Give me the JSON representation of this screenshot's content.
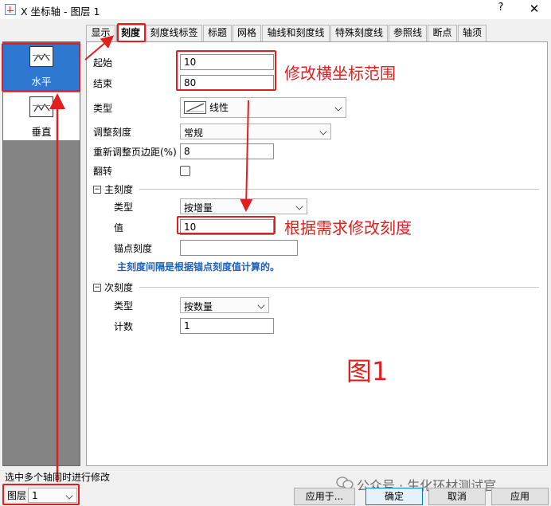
{
  "window": {
    "title": "X 坐标轴 - 图层 1",
    "help": "?",
    "close": "✕"
  },
  "sidebar": {
    "items": [
      {
        "label": "水平",
        "selected": true
      },
      {
        "label": "垂直",
        "selected": false
      }
    ]
  },
  "tabs": [
    "显示",
    "刻度",
    "刻度线标签",
    "标题",
    "网格",
    "轴线和刻度线",
    "特殊刻度线",
    "参照线",
    "断点",
    "轴须"
  ],
  "active_tab": "刻度",
  "scale": {
    "from_label": "起始",
    "from_value": "10",
    "to_label": "结束",
    "to_value": "80",
    "type_label": "类型",
    "type_value": "线性",
    "rescale_label": "调整刻度",
    "rescale_value": "常规",
    "margin_label": "重新调整页边距(%)",
    "margin_value": "8",
    "reverse_label": "翻转"
  },
  "major": {
    "header": "主刻度",
    "type_label": "类型",
    "type_value": "按增量",
    "value_label": "值",
    "value_value": "10",
    "anchor_label": "锚点刻度",
    "anchor_value": "",
    "hint": "主刻度间隔是根据锚点刻度值计算的。"
  },
  "minor": {
    "header": "次刻度",
    "type_label": "类型",
    "type_value": "按数量",
    "count_label": "计数",
    "count_value": "1"
  },
  "annotations": {
    "range_note": "修改横坐标范围",
    "tick_note": "根据需求修改刻度",
    "figure_label": "图1"
  },
  "bottom": {
    "hint": "选中多个轴同时进行修改",
    "layer_label": "图层",
    "layer_value": "1",
    "apply_to": "应用于...",
    "ok": "确定",
    "cancel": "取消",
    "apply": "应用"
  },
  "watermark": "公众号 · 生化环材测试官",
  "colors": {
    "annotation_red": "#e11f1f",
    "selection_blue": "#2e78d2",
    "hint_blue": "#1f5fbf"
  },
  "icons": {
    "axis_linear": "axis-linear-icon",
    "horizontal_axis": "horizontal-axis-icon",
    "vertical_axis": "vertical-axis-icon"
  }
}
